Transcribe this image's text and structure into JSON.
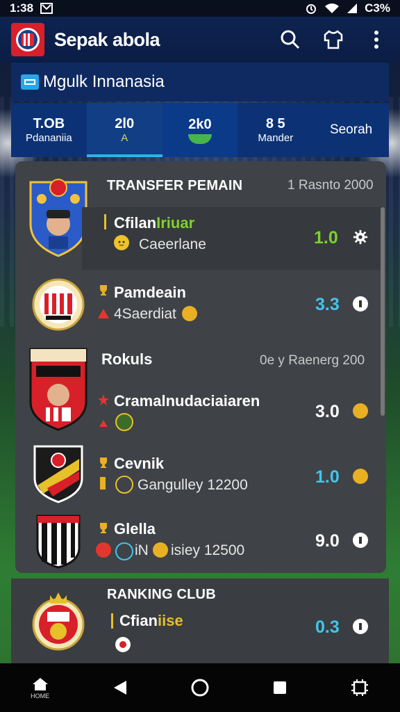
{
  "status": {
    "time": "1:38",
    "battery": "C3%"
  },
  "app": {
    "title": "Sepak abola",
    "brand_color": "#d7202a",
    "header_color": "#0e2350"
  },
  "league": {
    "name": "Mgulk Innanasia"
  },
  "tabs": [
    {
      "top": "T.OB",
      "bottom": "Pdananiia"
    },
    {
      "top": "2l0",
      "bottom": "A"
    },
    {
      "top": "2k0",
      "bottom": ""
    },
    {
      "top": "8 5",
      "bottom": "Mander"
    },
    {
      "top": "Seorah",
      "bottom": ""
    }
  ],
  "transfer": {
    "heading": "TRANSFER PEMAIN",
    "date": "1 Rasnto 2000",
    "rows": [
      {
        "name_a": "Cfilan",
        "name_b": "Iriuar",
        "sub": "Caeerlane",
        "score": "1.0",
        "score_color": "#7ed12e",
        "icon": "gear-icon"
      },
      {
        "name_a": "Pamdeain",
        "name_b": "",
        "sub": "4Saerdiat",
        "score": "3.3",
        "score_color": "#41c5ef",
        "icon": "info-icon"
      },
      {
        "name_a": "Rokuls",
        "name_b": "",
        "sub": "",
        "date": "0e y Raenerg 200",
        "score": "",
        "score_color": "",
        "icon": ""
      },
      {
        "name_a": "Cramalnudaciaiaren",
        "name_b": "",
        "sub": "",
        "score": "3.0",
        "score_color": "#ffffff",
        "icon": "coin-icon"
      },
      {
        "name_a": "Cevnik",
        "name_b": "",
        "sub": "Gangulley 12200",
        "score": "1.0",
        "score_color": "#41c5ef",
        "icon": "coin-icon"
      },
      {
        "name_a": "Glella",
        "name_b": "",
        "sub_prefix": "iN",
        "sub": "isiey 12500",
        "score": "9.0",
        "score_color": "#ffffff",
        "icon": "info-icon"
      }
    ]
  },
  "ranking": {
    "heading": "RANKING CLUB",
    "name_a": "Cfian",
    "name_b": "iise",
    "score": "0.3",
    "score_color": "#41c5ef"
  },
  "nav": {
    "home_label": "HOME"
  }
}
